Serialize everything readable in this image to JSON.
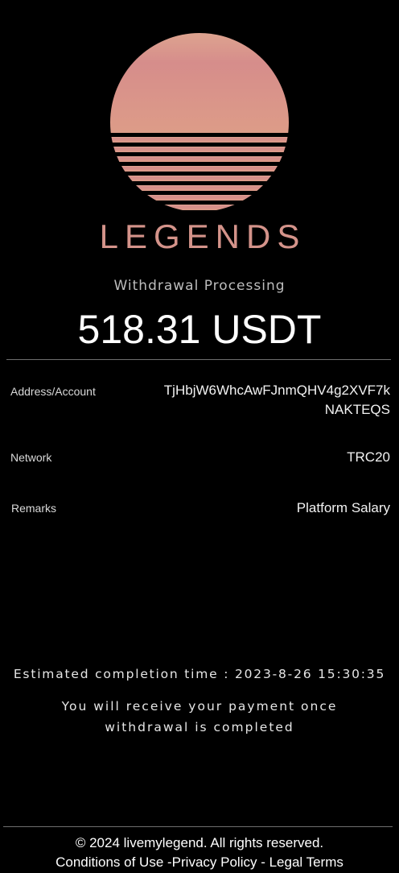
{
  "brand": {
    "logo_icon": "sunset-stripes-icon",
    "name": "LEGENDS",
    "color": "#d4938a"
  },
  "status": "Withdrawal Processing",
  "amount": "518.31 USDT",
  "details": {
    "address_label": "Address/Account",
    "address_value": "TjHbjW6WhcAwFJnmQHV4g2XVF7kNAKTEQS",
    "network_label": "Network",
    "network_value": "TRC20",
    "remarks_label": "Remarks",
    "remarks_value": "Platform Salary"
  },
  "estimate": "Estimated completion time : 2023-8-26 15:30:35",
  "notice_line1": "You will receive your payment once",
  "notice_line2": "withdrawal is completed",
  "footer": {
    "copyright": "© 2024 livemylegend. All rights reserved.",
    "conditions": "Conditions of Use",
    "privacy": "Privacy Policy",
    "legal": "Legal Terms"
  }
}
